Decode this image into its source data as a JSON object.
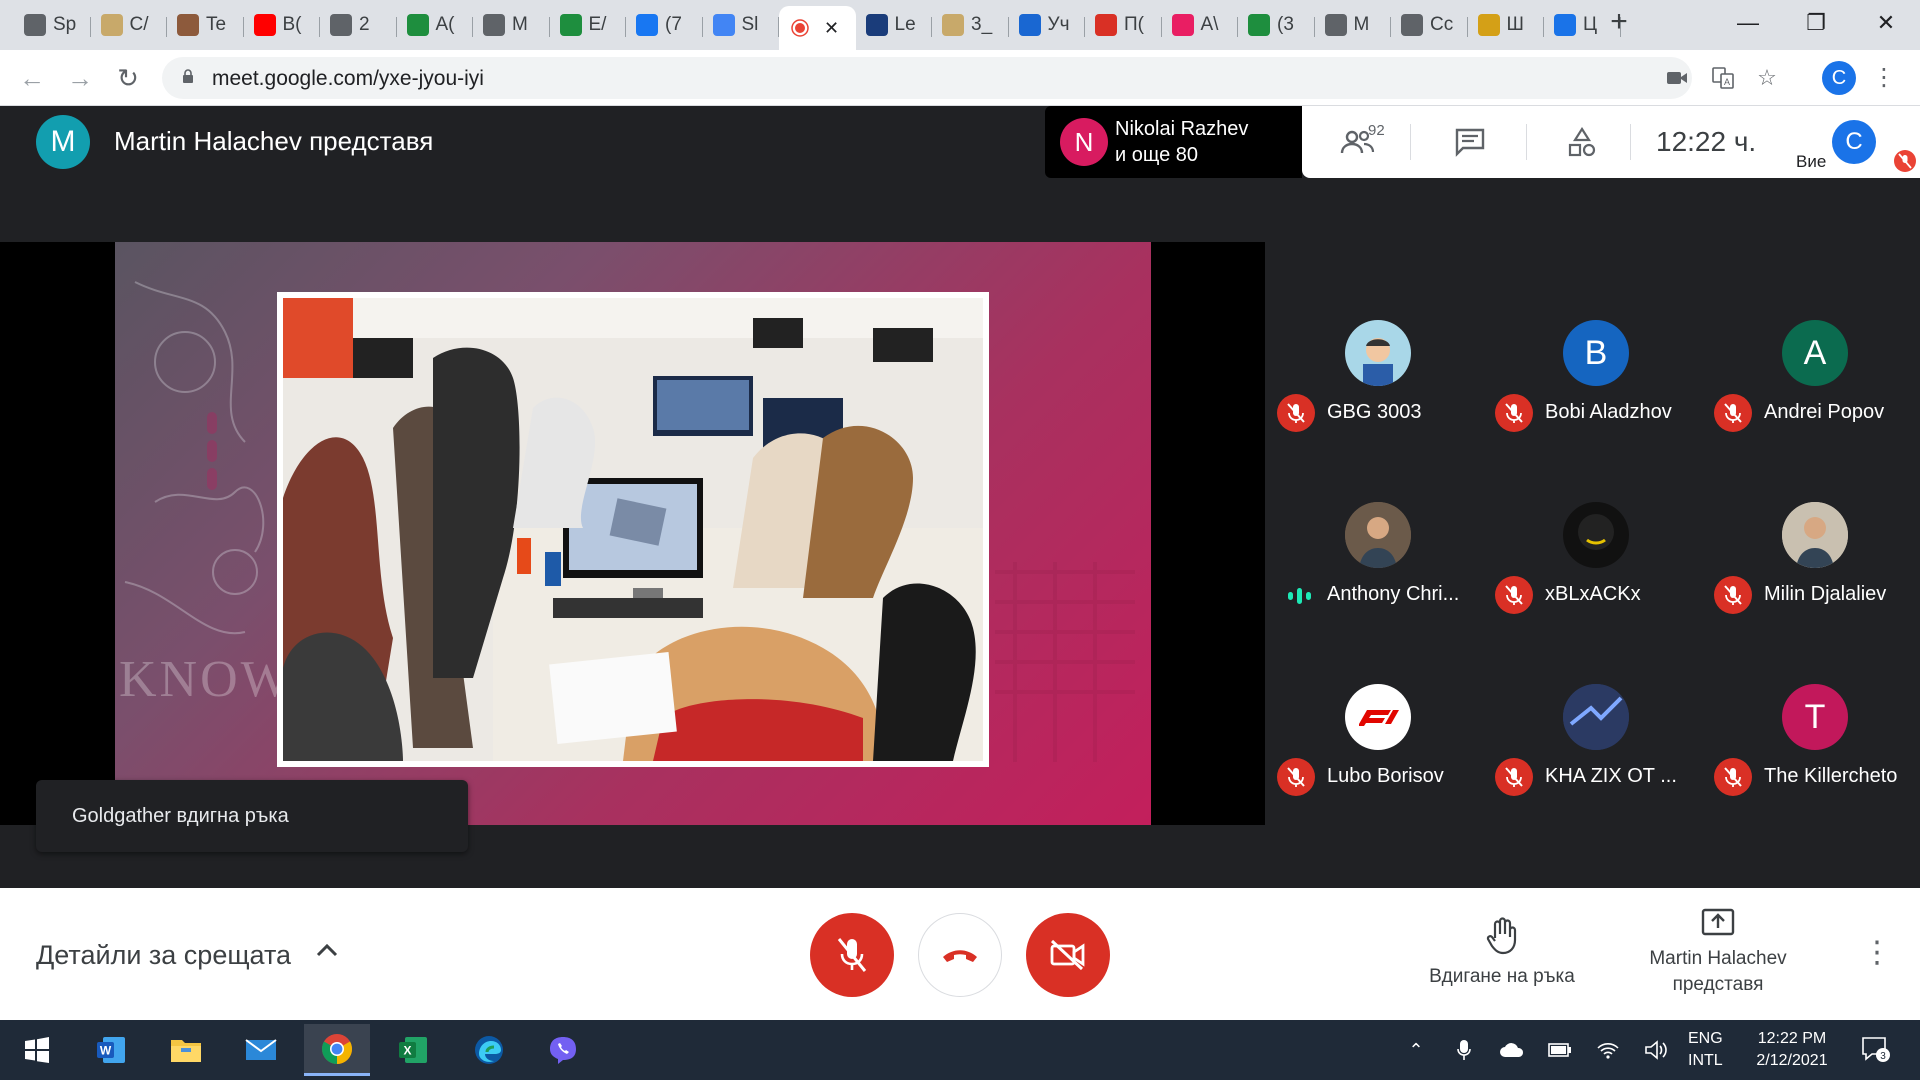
{
  "browser": {
    "tabs": [
      {
        "label": "Sp",
        "icon": "speedometer-icon",
        "color": "#5f6368"
      },
      {
        "label": "C/",
        "icon": "document-icon",
        "color": "#c8a96a"
      },
      {
        "label": "Te",
        "icon": "photo-icon",
        "color": "#8d5a3c"
      },
      {
        "label": "B(",
        "icon": "youtube-icon",
        "color": "#ff0000"
      },
      {
        "label": "2",
        "icon": "globe-icon",
        "color": "#5f6368"
      },
      {
        "label": "A(",
        "icon": "home-icon",
        "color": "#1e8e3e"
      },
      {
        "label": "M",
        "icon": "globe-icon",
        "color": "#5f6368"
      },
      {
        "label": "E/",
        "icon": "refresh-icon",
        "color": "#1e8e3e"
      },
      {
        "label": "(7",
        "icon": "facebook-icon",
        "color": "#1877f2"
      },
      {
        "label": "Sl",
        "icon": "stack-icon",
        "color": "#4285f4"
      },
      {
        "label": "",
        "icon": "record-icon",
        "color": "#ea4335",
        "active": true
      },
      {
        "label": "Le",
        "icon": "lex-icon",
        "color": "#1a3c7a"
      },
      {
        "label": "3_",
        "icon": "document-icon",
        "color": "#c8a96a"
      },
      {
        "label": "Уч",
        "icon": "book-icon",
        "color": "#1967d2"
      },
      {
        "label": "П(",
        "icon": "k-icon",
        "color": "#d93025"
      },
      {
        "label": "A\\",
        "icon": "letter-a-icon",
        "color": "#e91e63"
      },
      {
        "label": "(3",
        "icon": "home-icon",
        "color": "#1e8e3e"
      },
      {
        "label": "M",
        "icon": "mercedes-icon",
        "color": "#5f6368"
      },
      {
        "label": "Cc",
        "icon": "globe-icon",
        "color": "#5f6368"
      },
      {
        "label": "Ш",
        "icon": "emblem-icon",
        "color": "#d4a017"
      },
      {
        "label": "Ц",
        "icon": "g-icon",
        "color": "#1a73e8"
      }
    ],
    "url": "meet.google.com/yxe-jyou-iyi",
    "profile_initial": "C"
  },
  "meet": {
    "presenter_initial": "M",
    "presenter_title": "Martin Halachev представя",
    "active_speaker": {
      "initial": "N",
      "name": "Nikolai Razhev",
      "sub": "и още 80"
    },
    "participant_count": "92",
    "clock": "12:22 ч.",
    "self_label": "Вие",
    "self_initial": "C",
    "toast": "Goldgather вдигна ръка",
    "slide_text": "KNOW",
    "participants": [
      {
        "name": "GBG 3003",
        "avatar": "cartoon-avatar",
        "color": "#a9d7e8",
        "muted": true
      },
      {
        "name": "Bobi Aladzhov",
        "initial": "B",
        "color": "#1565c0",
        "muted": true
      },
      {
        "name": "Andrei Popov",
        "initial": "A",
        "color": "#0b6b4f",
        "muted": true
      },
      {
        "name": "Anthony Chri...",
        "avatar": "photo-avatar",
        "color": "#6b5a4a",
        "muted": false
      },
      {
        "name": "xBLxACKx",
        "avatar": "dark-avatar",
        "color": "#111111",
        "muted": true
      },
      {
        "name": "Milin Djalaliev",
        "avatar": "photo-avatar",
        "color": "#c9c0b0",
        "muted": true
      },
      {
        "name": "Lubo Borisov",
        "avatar": "f1-logo-avatar",
        "color": "#ffffff",
        "muted": true
      },
      {
        "name": "KHA ZIX OT ...",
        "avatar": "game-avatar",
        "color": "#2b3a63",
        "muted": true
      },
      {
        "name": "The Killercheto",
        "initial": "T",
        "color": "#c2185b",
        "muted": true
      }
    ],
    "controls": {
      "details": "Детайли за срещата",
      "raise_hand": "Вдигане на ръка",
      "presenting_line1": "Martin Halachev",
      "presenting_line2": "представя"
    }
  },
  "taskbar": {
    "apps": [
      "start-icon",
      "word-icon",
      "file-explorer-icon",
      "mail-icon",
      "chrome-icon",
      "excel-icon",
      "edge-icon",
      "viber-icon"
    ],
    "lang_line1": "ENG",
    "lang_line2": "INTL",
    "time": "12:22 PM",
    "date": "2/12/2021",
    "notifications": "3"
  }
}
